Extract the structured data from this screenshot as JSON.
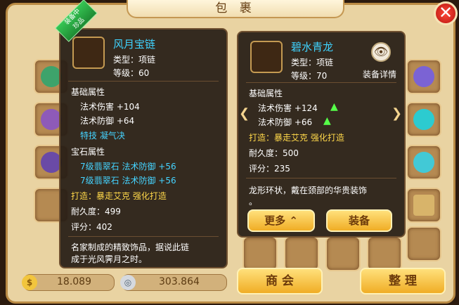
{
  "window": {
    "title": "包  裹",
    "close": "✕"
  },
  "left_item": {
    "badge": [
      "装备中",
      "珍品"
    ],
    "name": "风月宝链",
    "type_label": "类型：项链",
    "level_label": "等级：60",
    "base_title": "基础属性",
    "base_attrs": [
      "法术伤害 +104",
      "法术防御 +64"
    ],
    "special": "特技  凝气决",
    "gem_title": "宝石属性",
    "gems": [
      "7级翡翠石  法术防御 +56",
      "7级翡翠石  法术防御 +56"
    ],
    "forge": "打造：暴走艾克   强化打造",
    "durability": "耐久度：499",
    "score": "评分：402",
    "desc_line1": "名家制成的精致饰品，据说此链",
    "desc_line2": "成于光风霁月之时。"
  },
  "right_item": {
    "name": "碧水青龙",
    "type_label": "类型：项链",
    "level_label": "等级：70",
    "base_title": "基础属性",
    "base_attrs": [
      "法术伤害 +124",
      "法术防御 +66"
    ],
    "forge": "打造：暴走艾克   强化打造",
    "durability": "耐久度：500",
    "score": "评分：235",
    "desc": "龙形环状，戴在颈部的华贵装饰",
    "desc2": "。",
    "detail": "装备详情",
    "more_btn": "更多",
    "equip_btn": "装备"
  },
  "bottom": {
    "gold": "18.089",
    "silver": "303.864",
    "shop": "商  会",
    "sort": "整  理"
  },
  "colors": {
    "accent": "#ffd84a",
    "name": "#3fd3ff",
    "panel": "#2b1f16"
  },
  "icons": {
    "close": "close-icon",
    "eye": "eye-icon",
    "gold": "gold-coin-icon",
    "silver": "silver-coin-icon",
    "arrow_left": "chevron-left-icon",
    "arrow_right": "chevron-right-icon",
    "up": "up-arrow-icon"
  }
}
